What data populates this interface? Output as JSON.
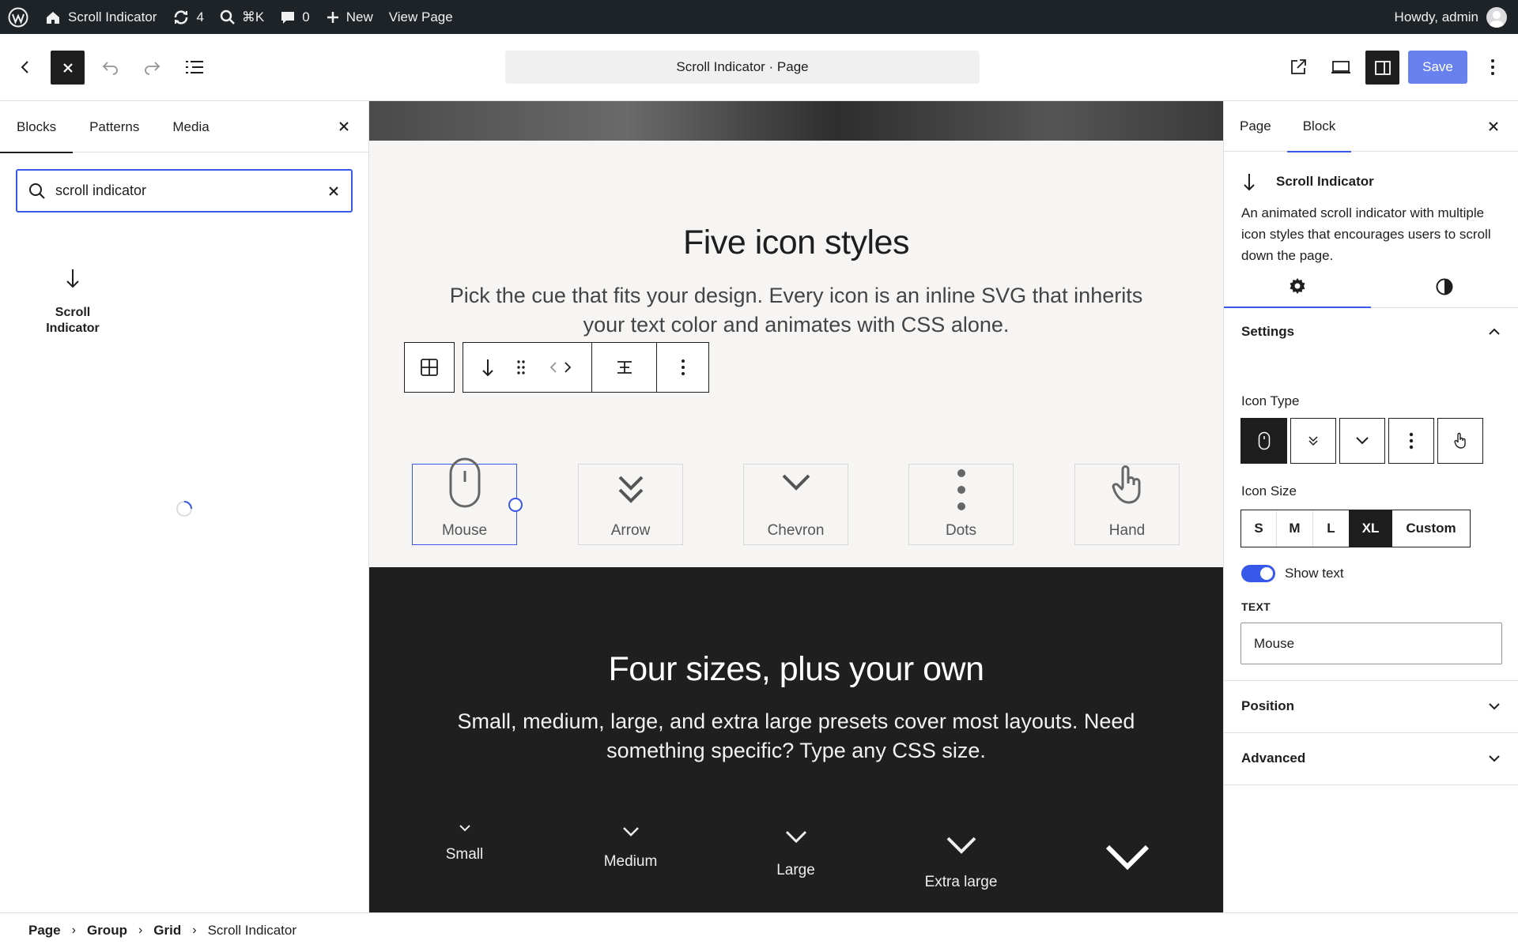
{
  "admin_bar": {
    "site_name": "Scroll Indicator",
    "updates_count": "4",
    "search_shortcut": "⌘K",
    "comments_count": "0",
    "new_label": "New",
    "view_page_label": "View Page",
    "howdy": "Howdy, admin"
  },
  "header": {
    "document_title": "Scroll Indicator · Page",
    "save_label": "Save"
  },
  "inserter": {
    "tabs": [
      "Blocks",
      "Patterns",
      "Media"
    ],
    "search_value": "scroll indicator",
    "result_label_line1": "Scroll",
    "result_label_line2": "Indicator"
  },
  "canvas": {
    "section1": {
      "heading": "Five icon styles",
      "paragraph": "Pick the cue that fits your design. Every icon is an inline SVG that inherits your text color and animates with CSS alone.",
      "cards": [
        "Mouse",
        "Arrow",
        "Chevron",
        "Dots",
        "Hand"
      ]
    },
    "section2": {
      "heading": "Four sizes, plus your own",
      "paragraph": "Small, medium, large, and extra large presets cover most layouts. Need something specific? Type any CSS size.",
      "sizes": [
        "Small",
        "Medium",
        "Large",
        "Extra large"
      ]
    }
  },
  "sidebar": {
    "tabs": [
      "Page",
      "Block"
    ],
    "block_name": "Scroll Indicator",
    "block_description": "An animated scroll indicator with multiple icon styles that encourages users to scroll down the page.",
    "settings_title": "Settings",
    "icon_type_label": "Icon Type",
    "icon_size_label": "Icon Size",
    "icon_sizes": [
      "S",
      "M",
      "L",
      "XL",
      "Custom"
    ],
    "icon_size_selected": "XL",
    "show_text_label": "Show text",
    "show_text_enabled": true,
    "text_label": "TEXT",
    "text_value": "Mouse",
    "position_title": "Position",
    "advanced_title": "Advanced"
  },
  "breadcrumb": [
    "Page",
    "Group",
    "Grid",
    "Scroll Indicator"
  ],
  "colors": {
    "accent": "#3858e9",
    "admin_bar": "#1d2327",
    "dark_section": "#1f1f1f",
    "light_section": "#f6f5f3"
  }
}
